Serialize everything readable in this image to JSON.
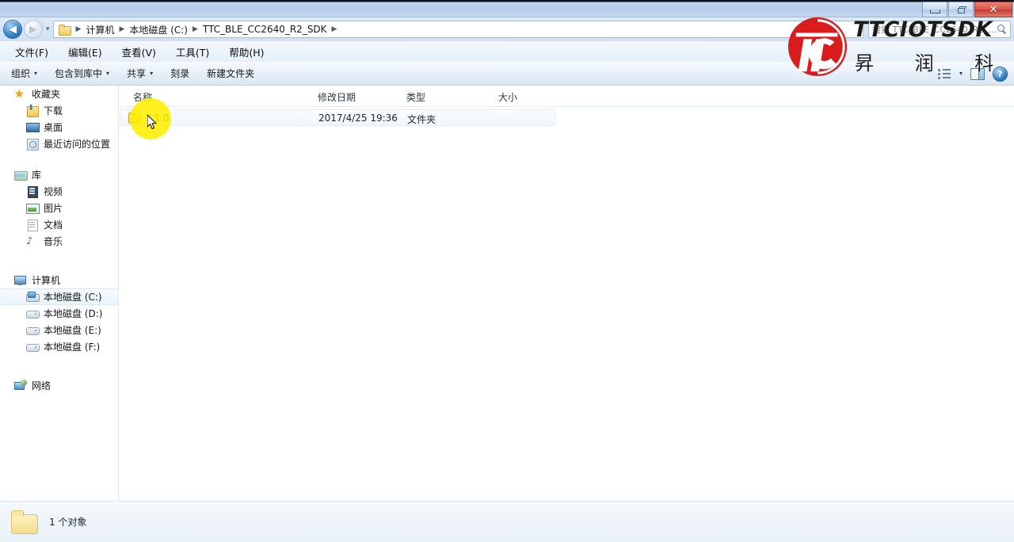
{
  "window": {
    "controls": {
      "minimize": "—",
      "restore": "❐",
      "close": "✕"
    }
  },
  "address": {
    "back_arrow": "◀",
    "forward_arrow": "▶",
    "history_caret": "▾",
    "folder_icon": "folder-icon",
    "separator": "▶",
    "crumbs": [
      "计算机",
      "本地磁盘 (C:)",
      "TTC_BLE_CC2640_R2_SDK"
    ],
    "search_placeholder": "搜索 TTC_BLE_CC2640_R2_SDK"
  },
  "menu": {
    "items": [
      {
        "label": "文件(F)"
      },
      {
        "label": "编辑(E)"
      },
      {
        "label": "查看(V)"
      },
      {
        "label": "工具(T)"
      },
      {
        "label": "帮助(H)"
      }
    ]
  },
  "toolbar": {
    "items": [
      {
        "label": "组织",
        "caret": "▾"
      },
      {
        "label": "包含到库中",
        "caret": "▾"
      },
      {
        "label": "共享",
        "caret": "▾"
      },
      {
        "label": "刻录",
        "caret": ""
      },
      {
        "label": "新建文件夹",
        "caret": ""
      }
    ],
    "views_caret": "▾",
    "help_glyph": "?"
  },
  "sidebar": {
    "groups": [
      {
        "header": {
          "label": "收藏夹",
          "icon": "star-icon"
        },
        "items": [
          {
            "label": "下载",
            "icon": "downloads-icon"
          },
          {
            "label": "桌面",
            "icon": "desktop-icon"
          },
          {
            "label": "最近访问的位置",
            "icon": "recent-places-icon"
          }
        ]
      },
      {
        "header": {
          "label": "库",
          "icon": "library-icon"
        },
        "items": [
          {
            "label": "视频",
            "icon": "video-icon"
          },
          {
            "label": "图片",
            "icon": "pictures-icon"
          },
          {
            "label": "文档",
            "icon": "documents-icon"
          },
          {
            "label": "音乐",
            "icon": "music-icon"
          }
        ]
      },
      {
        "header": {
          "label": "计算机",
          "icon": "computer-icon"
        },
        "items": [
          {
            "label": "本地磁盘 (C:)",
            "icon": "hard-drive-system-icon",
            "selected": true
          },
          {
            "label": "本地磁盘 (D:)",
            "icon": "hard-drive-icon",
            "selected": false
          },
          {
            "label": "本地磁盘 (E:)",
            "icon": "hard-drive-icon",
            "selected": false
          },
          {
            "label": "本地磁盘 (F:)",
            "icon": "hard-drive-icon",
            "selected": false
          }
        ]
      },
      {
        "header": {
          "label": "网络",
          "icon": "network-icon"
        },
        "items": []
      }
    ]
  },
  "filelist": {
    "columns": [
      {
        "label": "名称"
      },
      {
        "label": "修改日期"
      },
      {
        "label": "类型"
      },
      {
        "label": "大小"
      }
    ],
    "rows": [
      {
        "name": "3.1.0",
        "modified": "2017/4/25 19:36",
        "type": "文件夹",
        "size": ""
      }
    ]
  },
  "status": {
    "text": "1 个对象",
    "icon": "folder-icon"
  },
  "watermark": {
    "brand": "TTCIOTSDK",
    "subtitle": "昇 润 科 技",
    "logo_letters": "TTC",
    "color": "#d91d1d"
  }
}
